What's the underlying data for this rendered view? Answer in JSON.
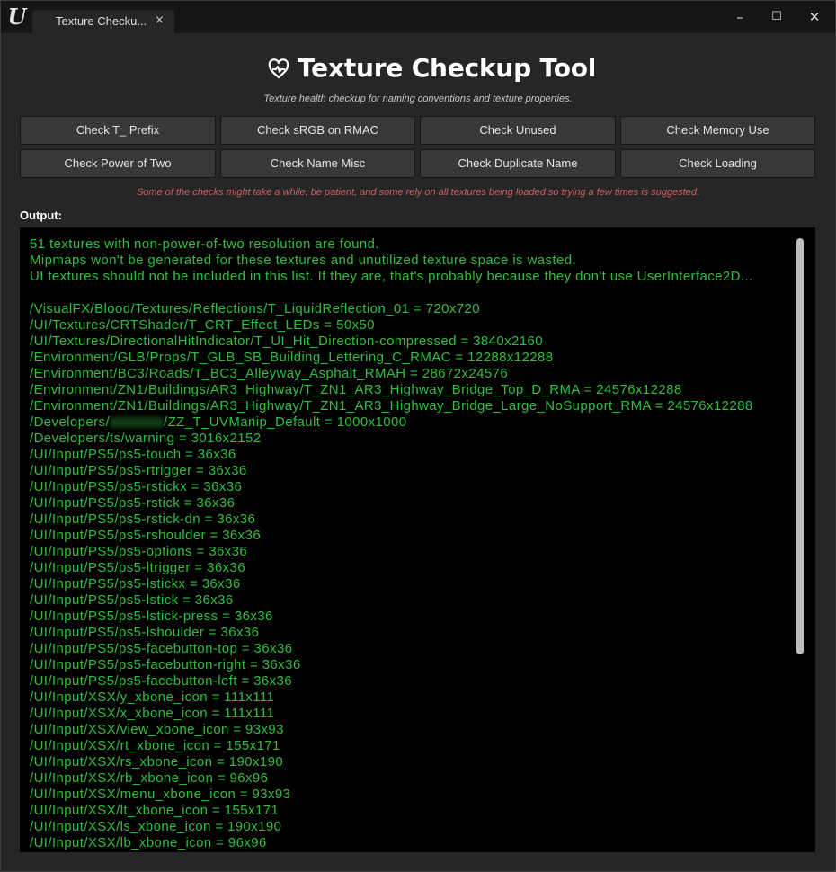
{
  "window": {
    "tab_title": "Texture Checku...",
    "close_tab_glyph": "×",
    "controls": {
      "minimize": "–",
      "maximize": "☐",
      "close": "✕"
    }
  },
  "header": {
    "title": "Texture Checkup Tool",
    "subtitle": "Texture health checkup for naming conventions and texture properties.",
    "icon": "heart-pulse-icon"
  },
  "buttons": {
    "row1": [
      "Check T_ Prefix",
      "Check sRGB on RMAC",
      "Check Unused",
      "Check Memory Use"
    ],
    "row2": [
      "Check Power of Two",
      "Check Name Misc",
      "Check Duplicate Name",
      "Check Loading"
    ]
  },
  "warning": "Some of the checks might take a while, be patient, and some rely on all textures being loaded so trying a few times is suggested.",
  "output": {
    "label": "Output:",
    "intro": [
      "51 textures with non-power-of-two resolution are found.",
      "Mipmaps won't be generated for these textures and unutilized texture space is wasted.",
      "UI textures should not be included in this list. If they are, that's probably because they don't use UserInterface2D..."
    ],
    "entries": [
      "/VisualFX/Blood/Textures/Reflections/T_LiquidReflection_01   =   720x720",
      "/UI/Textures/CRTShader/T_CRT_Effect_LEDs   =   50x50",
      "/UI/Textures/DirectionalHitIndicator/T_UI_Hit_Direction-compressed   =   3840x2160",
      "/Environment/GLB/Props/T_GLB_SB_Building_Lettering_C_RMAC   =   12288x12288",
      "/Environment/BC3/Roads/T_BC3_Alleyway_Asphalt_RMAH   =   28672x24576",
      "/Environment/ZN1/Buildings/AR3_Highway/T_ZN1_AR3_Highway_Bridge_Top_D_RMA   =   24576x12288",
      "/Environment/ZN1/Buildings/AR3_Highway/T_ZN1_AR3_Highway_Bridge_Large_NoSupport_RMA   =   24576x12288",
      "__BLUR__",
      "/Developers/ts/warning   =   3016x2152",
      "/UI/Input/PS5/ps5-touch   =   36x36",
      "/UI/Input/PS5/ps5-rtrigger   =   36x36",
      "/UI/Input/PS5/ps5-rstickx   =   36x36",
      "/UI/Input/PS5/ps5-rstick   =   36x36",
      "/UI/Input/PS5/ps5-rstick-dn   =   36x36",
      "/UI/Input/PS5/ps5-rshoulder   =   36x36",
      "/UI/Input/PS5/ps5-options   =   36x36",
      "/UI/Input/PS5/ps5-ltrigger   =   36x36",
      "/UI/Input/PS5/ps5-lstickx   =   36x36",
      "/UI/Input/PS5/ps5-lstick   =   36x36",
      "/UI/Input/PS5/ps5-lstick-press   =   36x36",
      "/UI/Input/PS5/ps5-lshoulder   =   36x36",
      "/UI/Input/PS5/ps5-facebutton-top   =   36x36",
      "/UI/Input/PS5/ps5-facebutton-right   =   36x36",
      "/UI/Input/PS5/ps5-facebutton-left   =   36x36",
      "/UI/Input/XSX/y_xbone_icon   =   111x111",
      "/UI/Input/XSX/x_xbone_icon   =   111x111",
      "/UI/Input/XSX/view_xbone_icon   =   93x93",
      "/UI/Input/XSX/rt_xbone_icon   =   155x171",
      "/UI/Input/XSX/rs_xbone_icon   =   190x190",
      "/UI/Input/XSX/rb_xbone_icon   =   96x96",
      "/UI/Input/XSX/menu_xbone_icon   =   93x93",
      "/UI/Input/XSX/lt_xbone_icon   =   155x171",
      "/UI/Input/XSX/ls_xbone_icon   =   190x190",
      "/UI/Input/XSX/lb_xbone_icon   =   96x96"
    ],
    "blurred_entry": {
      "prefix": "/Developers/",
      "suffix": "/ZZ_T_UVManip_Default   =   1000x1000"
    }
  },
  "colors": {
    "output_text": "#2fbf3a",
    "warning_text": "#c86464",
    "button_bg": "#383838",
    "panel_bg": "#262626"
  }
}
